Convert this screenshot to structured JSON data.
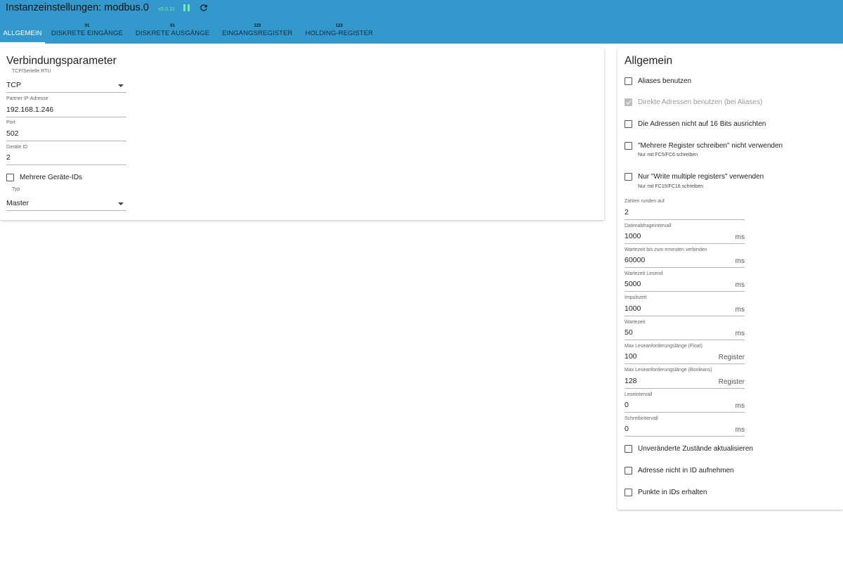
{
  "header": {
    "title": "Instanzeinstellungen: modbus.0",
    "version": "v5.0.11",
    "pause_icon": "pause-icon",
    "refresh_icon": "refresh-icon",
    "accent_color": "#3399cc"
  },
  "tabs": [
    {
      "count": "",
      "label": "ALLGEMEIN"
    },
    {
      "count": "01",
      "label": "DISKRETE EINGÄNGE"
    },
    {
      "count": "01",
      "label": "DISKRETE AUSGÄNGE"
    },
    {
      "count": "123",
      "label": "EINGANGSREGISTER"
    },
    {
      "count": "123",
      "label": "HOLDING-REGISTER"
    }
  ],
  "connection": {
    "title": "Verbindungsparameter",
    "mode_label": "TCP/Serielle RTU",
    "mode_value": "TCP",
    "ip_label": "Partner IP-Adresse",
    "ip_value": "192.168.1.246",
    "port_label": "Port",
    "port_value": "502",
    "device_id_label": "Geräte ID",
    "device_id_value": "2",
    "multi_ids_label": "Mehrere Geräte-IDs",
    "type_label": "Typ",
    "type_value": "Master"
  },
  "general": {
    "title": "Allgemein",
    "checks": {
      "aliases": "Aliases benutzen",
      "direct": "Direkte Adressen benutzen (bei Aliases)",
      "align16": "Die Adressen nicht auf 16 Bits ausrichten",
      "multi_write": "\"Mehrere Register schreiben\" nicht verwenden",
      "multi_write_hint": "Nur mit FC5/FC6 schreiben",
      "write_multiple": "Nur \"Write multiple registers\" verwenden",
      "write_multiple_hint": "Nur mit FC15/FC16 schreiben",
      "unchanged": "Unveränderte Zustände aktualisieren",
      "no_address_id": "Adresse nicht in ID aufnehmen",
      "keep_dots": "Punkte in IDs erhalten"
    },
    "fields": [
      {
        "label": "Zahlen runden auf",
        "value": "2",
        "unit": ""
      },
      {
        "label": "Datenabfrageintervall",
        "value": "1000",
        "unit": "ms"
      },
      {
        "label": "Wartezeit bis zum erneuten verbinden",
        "value": "60000",
        "unit": "ms"
      },
      {
        "label": "Wartezeit Lesend",
        "value": "5000",
        "unit": "ms"
      },
      {
        "label": "Impulszeit",
        "value": "1000",
        "unit": "ms"
      },
      {
        "label": "Wartezeit",
        "value": "50",
        "unit": "ms"
      },
      {
        "label": "Max Leseanforderungslänge (Float)",
        "value": "100",
        "unit": "Register"
      },
      {
        "label": "Max Leseanforderungslänge (Booleans)",
        "value": "128",
        "unit": "Register"
      },
      {
        "label": "Leseintervall",
        "value": "0",
        "unit": "ms"
      },
      {
        "label": "Schreibintervall",
        "value": "0",
        "unit": "ms"
      }
    ]
  }
}
